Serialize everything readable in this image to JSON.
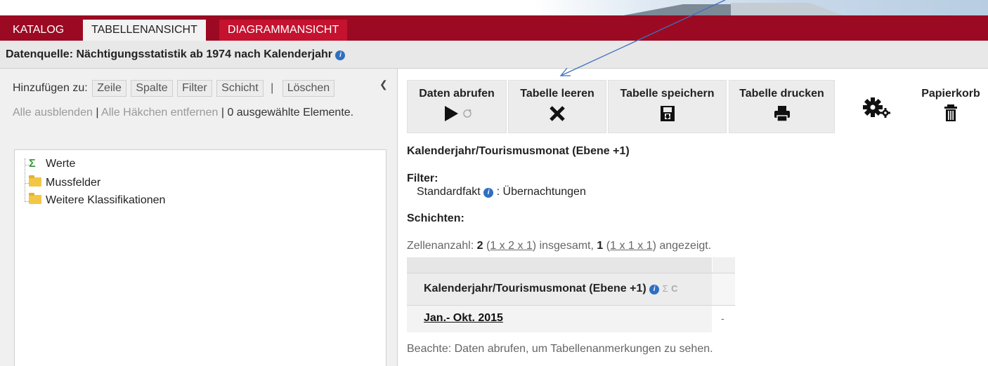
{
  "nav": {
    "tabs": [
      {
        "label": "KATALOG"
      },
      {
        "label": "TABELLENANSICHT"
      },
      {
        "label": "DIAGRAMMANSICHT"
      }
    ]
  },
  "subheader": {
    "title": "Datenquelle: Nächtigungsstatistik ab 1974 nach Kalenderjahr"
  },
  "left": {
    "add_label": "Hinzufügen zu:",
    "add_buttons": [
      "Zeile",
      "Spalte",
      "Filter",
      "Schicht"
    ],
    "separator": "|",
    "delete_label": "Löschen",
    "collapse_icon": "chevron-left-icon",
    "hide_all": "Alle ausblenden",
    "remove_checks": "Alle Häkchen entfernen",
    "selected_count": "0 ausgewählte Elemente.",
    "tree": [
      {
        "label": "Werte",
        "icon": "sigma-icon"
      },
      {
        "label": "Mussfelder",
        "icon": "folder-icon"
      },
      {
        "label": "Weitere Klassifikationen",
        "icon": "folder-icon"
      }
    ]
  },
  "toolbar": {
    "fetch": "Daten abrufen",
    "clear": "Tabelle leeren",
    "save": "Tabelle speichern",
    "print": "Tabelle drucken",
    "settings_icon": "gears-icon",
    "trash": "Papierkorb"
  },
  "content": {
    "row_dimension": "Kalenderjahr/Tourismusmonat (Ebene +1)",
    "filter_label": "Filter:",
    "filter_name": "Standardfakt",
    "filter_value": ": Übernachtungen",
    "layers_label": "Schichten:",
    "cell_prefix": "Zellenanzahl:",
    "cell_total": "2",
    "cell_total_dims": "1 x 2 x 1",
    "cell_mid": "insgesamt,",
    "cell_shown": "1",
    "cell_shown_dims": "1 x 1 x 1",
    "cell_suffix": "angezeigt.",
    "table_header": "Kalenderjahr/Tourismusmonat (Ebene +1)",
    "table_row_label": "Jan.- Okt. 2015",
    "table_row_value": "-",
    "note": "Beachte: Daten abrufen, um Tabellenanmerkungen zu sehen."
  },
  "colors": {
    "brand_dark": "#9b0a22",
    "brand_red": "#c4122f",
    "annotation_arrow": "#3d6fc2"
  }
}
